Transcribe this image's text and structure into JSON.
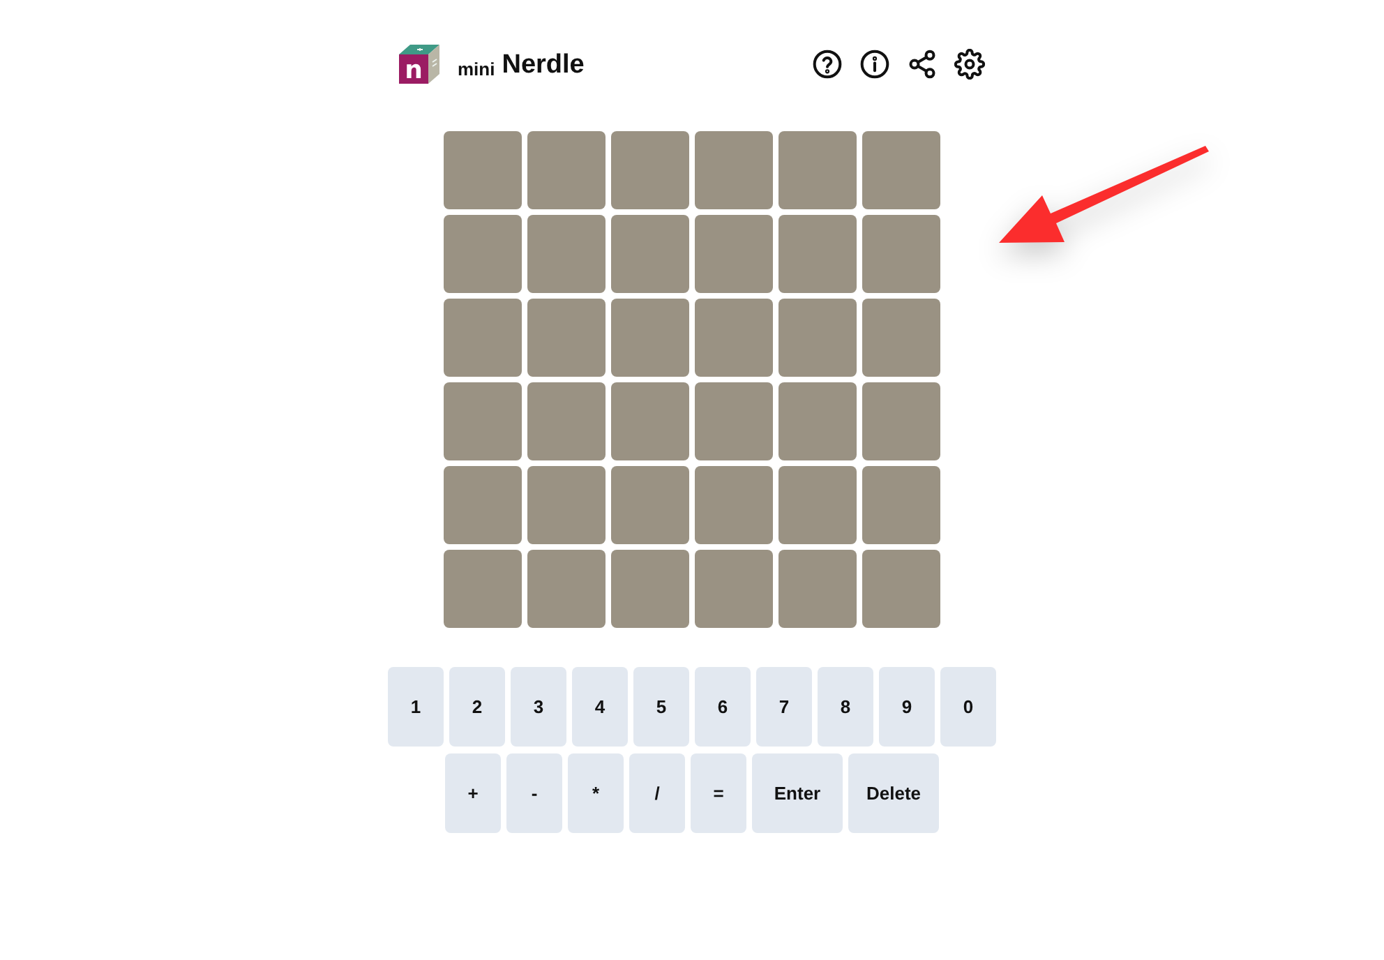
{
  "header": {
    "logo_letter": "n",
    "title_prefix": "mini",
    "title": "Nerdle",
    "toolbar": [
      {
        "kind": "help"
      },
      {
        "kind": "info"
      },
      {
        "kind": "share"
      },
      {
        "kind": "settings"
      }
    ]
  },
  "board": {
    "rows": [
      {
        "tiles": [
          {
            "kind": "empty"
          },
          {
            "kind": "empty"
          },
          {
            "kind": "empty"
          },
          {
            "kind": "empty"
          },
          {
            "kind": "empty"
          },
          {
            "kind": "empty"
          }
        ]
      },
      {
        "tiles": [
          {
            "kind": "empty"
          },
          {
            "kind": "empty"
          },
          {
            "kind": "empty"
          },
          {
            "kind": "empty"
          },
          {
            "kind": "empty"
          },
          {
            "kind": "empty"
          }
        ]
      },
      {
        "tiles": [
          {
            "kind": "empty"
          },
          {
            "kind": "empty"
          },
          {
            "kind": "empty"
          },
          {
            "kind": "empty"
          },
          {
            "kind": "empty"
          },
          {
            "kind": "empty"
          }
        ]
      },
      {
        "tiles": [
          {
            "kind": "empty"
          },
          {
            "kind": "empty"
          },
          {
            "kind": "empty"
          },
          {
            "kind": "empty"
          },
          {
            "kind": "empty"
          },
          {
            "kind": "empty"
          }
        ]
      },
      {
        "tiles": [
          {
            "kind": "empty"
          },
          {
            "kind": "empty"
          },
          {
            "kind": "empty"
          },
          {
            "kind": "empty"
          },
          {
            "kind": "empty"
          },
          {
            "kind": "empty"
          }
        ]
      },
      {
        "tiles": [
          {
            "kind": "empty"
          },
          {
            "kind": "empty"
          },
          {
            "kind": "empty"
          },
          {
            "kind": "empty"
          },
          {
            "kind": "empty"
          },
          {
            "kind": "empty"
          }
        ]
      }
    ]
  },
  "keyboard": {
    "rows": [
      {
        "keys": [
          {
            "label": "1",
            "kind": "char"
          },
          {
            "label": "2",
            "kind": "char"
          },
          {
            "label": "3",
            "kind": "char"
          },
          {
            "label": "4",
            "kind": "char"
          },
          {
            "label": "5",
            "kind": "char"
          },
          {
            "label": "6",
            "kind": "char"
          },
          {
            "label": "7",
            "kind": "char"
          },
          {
            "label": "8",
            "kind": "char"
          },
          {
            "label": "9",
            "kind": "char"
          },
          {
            "label": "0",
            "kind": "char"
          }
        ]
      },
      {
        "keys": [
          {
            "label": "+",
            "kind": "char"
          },
          {
            "label": "-",
            "kind": "char"
          },
          {
            "label": "*",
            "kind": "char"
          },
          {
            "label": "/",
            "kind": "char"
          },
          {
            "label": "=",
            "kind": "char"
          },
          {
            "label": "Enter",
            "kind": "action"
          },
          {
            "label": "Delete",
            "kind": "action"
          }
        ]
      }
    ]
  },
  "annotations": [
    {
      "kind": "arrow"
    }
  ]
}
